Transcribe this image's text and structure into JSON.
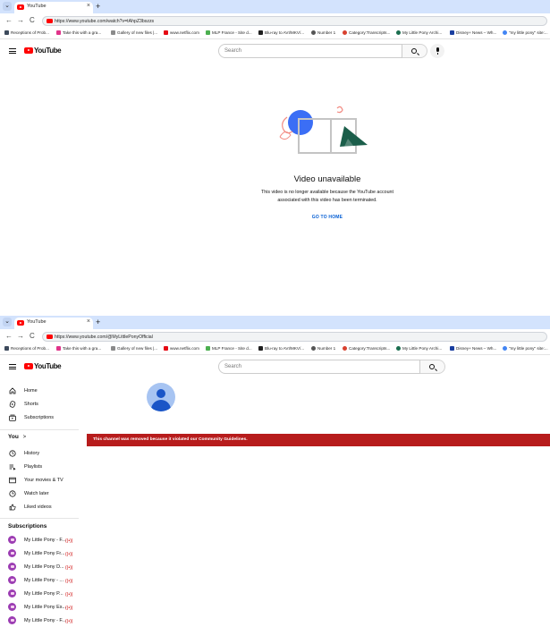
{
  "window1": {
    "tab": {
      "title": "YouTube"
    },
    "new_tab": "+",
    "tab_menu": "⌄",
    "nav": {
      "back": "←",
      "forward": "→",
      "reload": "C"
    },
    "url": "https://www.youtube.com/watch?v=tAhpZ3bszzs",
    "search_placeholder": "Search",
    "error": {
      "title": "Video unavailable",
      "message_line1": "This video is no longer available because the YouTube account",
      "message_line2": "associated with this video has been terminated.",
      "button": "GO TO HOME"
    }
  },
  "window2": {
    "tab": {
      "title": "YouTube"
    },
    "new_tab": "+",
    "tab_menu": "⌄",
    "nav": {
      "back": "←",
      "forward": "→",
      "reload": "C"
    },
    "url": "https://www.youtube.com/@MyLittlePonyOfficial",
    "search_placeholder": "Search",
    "guide": {
      "main": [
        {
          "label": "Home",
          "icon": "home-icon"
        },
        {
          "label": "Shorts",
          "icon": "shorts-icon"
        },
        {
          "label": "Subscriptions",
          "icon": "subscriptions-icon"
        }
      ],
      "you_heading": "You",
      "you_chevron": ">",
      "you_items": [
        {
          "label": "History",
          "icon": "history-icon"
        },
        {
          "label": "Playlists",
          "icon": "playlists-icon"
        },
        {
          "label": "Your movies & TV",
          "icon": "movies-icon"
        },
        {
          "label": "Watch later",
          "icon": "watch-later-icon"
        },
        {
          "label": "Liked videos",
          "icon": "liked-icon"
        }
      ],
      "subscriptions_heading": "Subscriptions",
      "subscriptions": [
        {
          "label": "My Little Pony - F..."
        },
        {
          "label": "My Little Pony Fr..."
        },
        {
          "label": "My Little Pony D..."
        },
        {
          "label": "My Little Pony - ..."
        },
        {
          "label": "My Little Pony P..."
        },
        {
          "label": "My Little Pony Es..."
        },
        {
          "label": "My Little Pony - F..."
        }
      ],
      "live_indicator": "((•))"
    },
    "banner": "This channel was removed because it violated our Community Guidelines."
  },
  "bookmarks": [
    {
      "label": "Receptions of Prob...",
      "color": "#3d4a5c"
    },
    {
      "label": "Take this with a gra...",
      "color": "#e0338a"
    },
    {
      "label": "Gallery of new files |...",
      "color": "#8a8a8a"
    },
    {
      "label": "www.netflix.com",
      "color": "#e50914"
    },
    {
      "label": "MLP France - Site d...",
      "color": "#4caf50"
    },
    {
      "label": "Blu-ray to AVI/MKV/...",
      "color": "#1f1f1f"
    },
    {
      "label": "Number 1",
      "color": "#555555"
    },
    {
      "label": "Category:Transcripts...",
      "color": "#d8412f"
    },
    {
      "label": "My Little Pony Archi...",
      "color": "#1b6e4f"
    },
    {
      "label": "Disney+ News – Wh...",
      "color": "#1a3fa0"
    },
    {
      "label": "\"my little pony\" site:...",
      "color": "#4285f4"
    }
  ],
  "logo_text": "YouTube",
  "colors": {
    "tabstrip": "#d3e3fd",
    "youtube_red": "#ff0000",
    "banner_red": "#b71c1c",
    "link_blue": "#065fd4"
  }
}
